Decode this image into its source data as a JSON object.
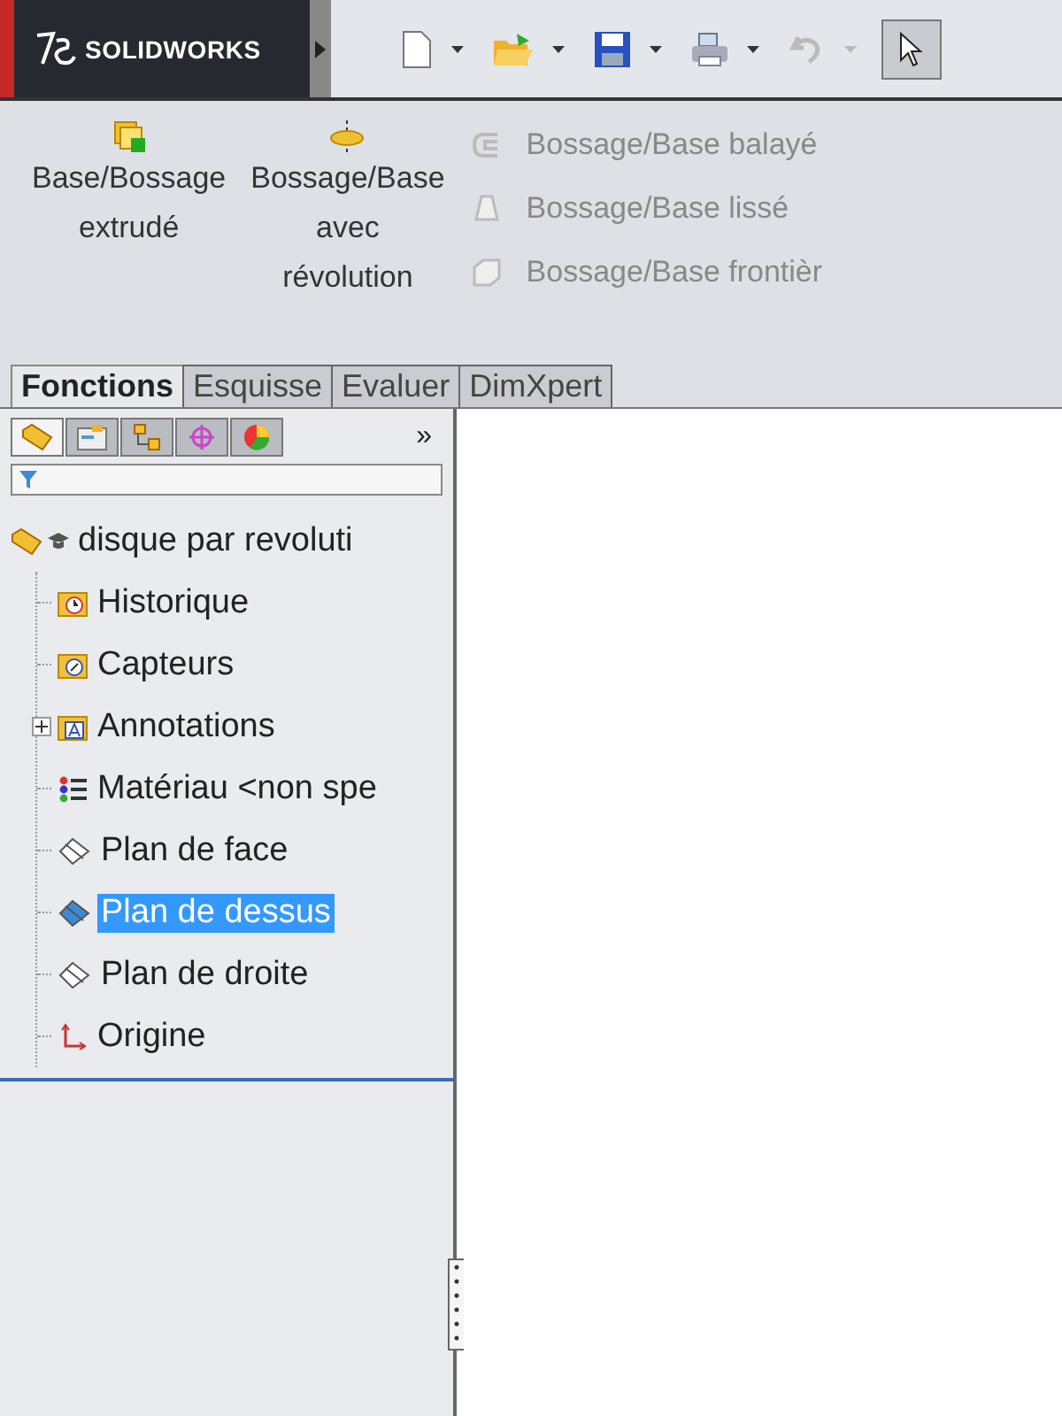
{
  "app": {
    "logo": "SOLIDWORKS"
  },
  "toolbar": [
    {
      "kind": "new",
      "disabled": false
    },
    {
      "kind": "open",
      "disabled": false
    },
    {
      "kind": "save",
      "disabled": false
    },
    {
      "kind": "print",
      "disabled": false
    },
    {
      "kind": "undo",
      "disabled": true
    },
    {
      "kind": "select",
      "disabled": false
    }
  ],
  "ribbon": {
    "large": [
      {
        "kind": "extrude",
        "lines": [
          "Base/Bossage",
          "extrudé"
        ],
        "disabled": false
      },
      {
        "kind": "revolve",
        "lines": [
          "Bossage/Base",
          "avec",
          "révolution"
        ],
        "disabled": false
      }
    ],
    "small": [
      {
        "kind": "sweep",
        "label": "Bossage/Base balayé",
        "disabled": true
      },
      {
        "kind": "loft",
        "label": "Bossage/Base lissé",
        "disabled": true
      },
      {
        "kind": "boundary",
        "label": "Bossage/Base frontièr",
        "disabled": true
      }
    ]
  },
  "tabs": [
    {
      "label": "Fonctions",
      "selected": true
    },
    {
      "label": "Esquisse",
      "selected": false
    },
    {
      "label": "Evaluer",
      "selected": false
    },
    {
      "label": "DimXpert",
      "selected": false
    }
  ],
  "panel_tabs": [
    {
      "kind": "tree",
      "selected": true
    },
    {
      "kind": "properties",
      "selected": false
    },
    {
      "kind": "config",
      "selected": false
    },
    {
      "kind": "dimxpert",
      "selected": false
    },
    {
      "kind": "display",
      "selected": false
    }
  ],
  "panel_more": "»",
  "tree": {
    "label": "disque par revoluti",
    "children": [
      {
        "label": "Historique",
        "kind": "history",
        "expandable": false,
        "selected": false
      },
      {
        "label": "Capteurs",
        "kind": "sensors",
        "expandable": false,
        "selected": false
      },
      {
        "label": "Annotations",
        "kind": "annotations",
        "expandable": true,
        "selected": false
      },
      {
        "label": "Matériau <non spe",
        "kind": "material",
        "expandable": false,
        "selected": false
      },
      {
        "label": "Plan de face",
        "kind": "plane",
        "expandable": false,
        "selected": false
      },
      {
        "label": "Plan de dessus",
        "kind": "plane",
        "expandable": false,
        "selected": true
      },
      {
        "label": "Plan de droite",
        "kind": "plane",
        "expandable": false,
        "selected": false
      },
      {
        "label": "Origine",
        "kind": "origin",
        "expandable": false,
        "selected": false
      }
    ]
  }
}
